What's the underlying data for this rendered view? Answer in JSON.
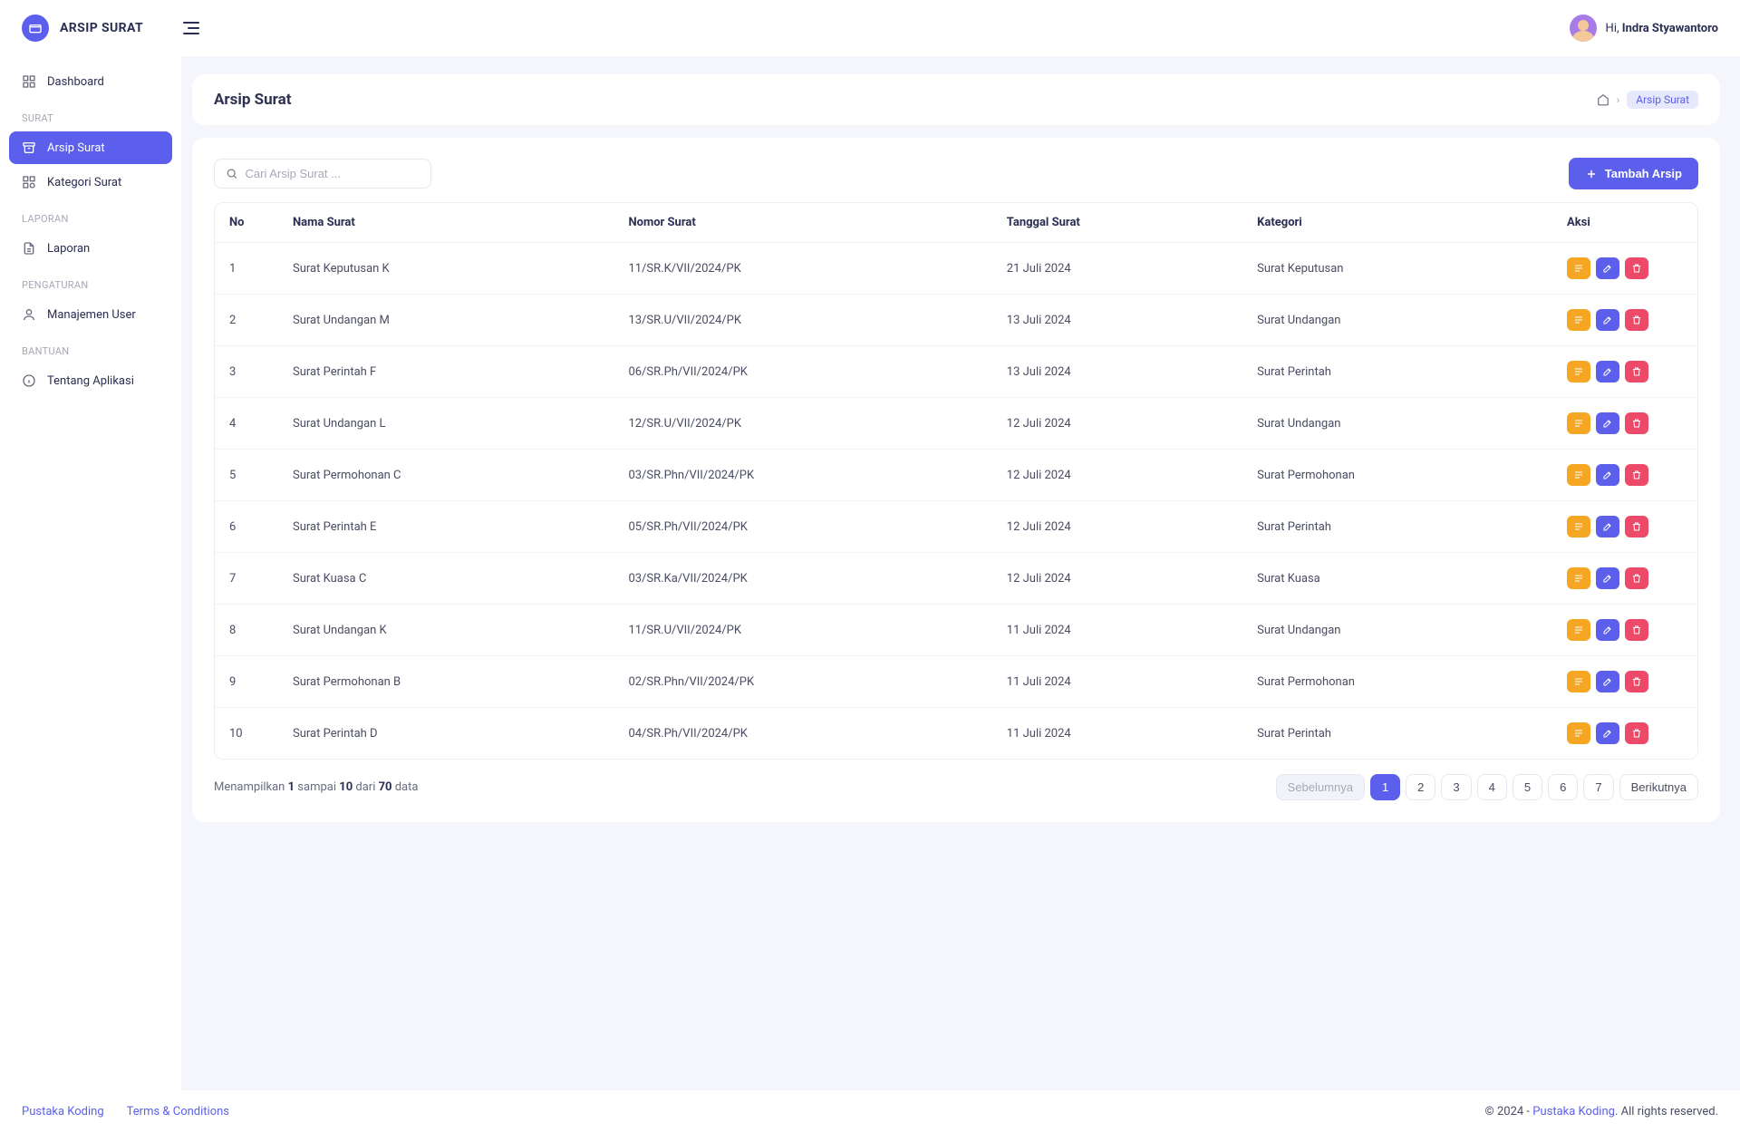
{
  "app": {
    "name": "ARSIP SURAT"
  },
  "user": {
    "greeting": "Hi,",
    "name": "Indra Styawantoro"
  },
  "sidebar": {
    "items": [
      {
        "label": "Dashboard"
      },
      {
        "section": "SURAT"
      },
      {
        "label": "Arsip Surat"
      },
      {
        "label": "Kategori Surat"
      },
      {
        "section": "LAPORAN"
      },
      {
        "label": "Laporan"
      },
      {
        "section": "PENGATURAN"
      },
      {
        "label": "Manajemen User"
      },
      {
        "section": "BANTUAN"
      },
      {
        "label": "Tentang Aplikasi"
      }
    ]
  },
  "page": {
    "title": "Arsip Surat",
    "breadcrumb_current": "Arsip Surat"
  },
  "toolbar": {
    "search_placeholder": "Cari Arsip Surat ...",
    "add_label": "Tambah Arsip"
  },
  "table": {
    "headers": [
      "No",
      "Nama Surat",
      "Nomor Surat",
      "Tanggal Surat",
      "Kategori",
      "Aksi"
    ],
    "rows": [
      {
        "no": "1",
        "nama": "Surat Keputusan K",
        "nomor": "11/SR.K/VII/2024/PK",
        "tanggal": "21 Juli 2024",
        "kategori": "Surat Keputusan"
      },
      {
        "no": "2",
        "nama": "Surat Undangan M",
        "nomor": "13/SR.U/VII/2024/PK",
        "tanggal": "13 Juli 2024",
        "kategori": "Surat Undangan"
      },
      {
        "no": "3",
        "nama": "Surat Perintah F",
        "nomor": "06/SR.Ph/VII/2024/PK",
        "tanggal": "13 Juli 2024",
        "kategori": "Surat Perintah"
      },
      {
        "no": "4",
        "nama": "Surat Undangan L",
        "nomor": "12/SR.U/VII/2024/PK",
        "tanggal": "12 Juli 2024",
        "kategori": "Surat Undangan"
      },
      {
        "no": "5",
        "nama": "Surat Permohonan C",
        "nomor": "03/SR.Phn/VII/2024/PK",
        "tanggal": "12 Juli 2024",
        "kategori": "Surat Permohonan"
      },
      {
        "no": "6",
        "nama": "Surat Perintah E",
        "nomor": "05/SR.Ph/VII/2024/PK",
        "tanggal": "12 Juli 2024",
        "kategori": "Surat Perintah"
      },
      {
        "no": "7",
        "nama": "Surat Kuasa C",
        "nomor": "03/SR.Ka/VII/2024/PK",
        "tanggal": "12 Juli 2024",
        "kategori": "Surat Kuasa"
      },
      {
        "no": "8",
        "nama": "Surat Undangan K",
        "nomor": "11/SR.U/VII/2024/PK",
        "tanggal": "11 Juli 2024",
        "kategori": "Surat Undangan"
      },
      {
        "no": "9",
        "nama": "Surat Permohonan B",
        "nomor": "02/SR.Phn/VII/2024/PK",
        "tanggal": "11 Juli 2024",
        "kategori": "Surat Permohonan"
      },
      {
        "no": "10",
        "nama": "Surat Perintah D",
        "nomor": "04/SR.Ph/VII/2024/PK",
        "tanggal": "11 Juli 2024",
        "kategori": "Surat Perintah"
      }
    ]
  },
  "pagination": {
    "summary_prefix": "Menampilkan ",
    "from": "1",
    "mid1": " sampai ",
    "to": "10",
    "mid2": " dari ",
    "total": "70",
    "suffix": " data",
    "prev": "Sebelumnya",
    "next": "Berikutnya",
    "pages": [
      "1",
      "2",
      "3",
      "4",
      "5",
      "6",
      "7"
    ],
    "active": "1"
  },
  "footer": {
    "link1": "Pustaka Koding",
    "link2": "Terms & Conditions",
    "copy_prefix": "© 2024 - ",
    "copy_link": "Pustaka Koding",
    "copy_suffix": ". All rights reserved."
  }
}
